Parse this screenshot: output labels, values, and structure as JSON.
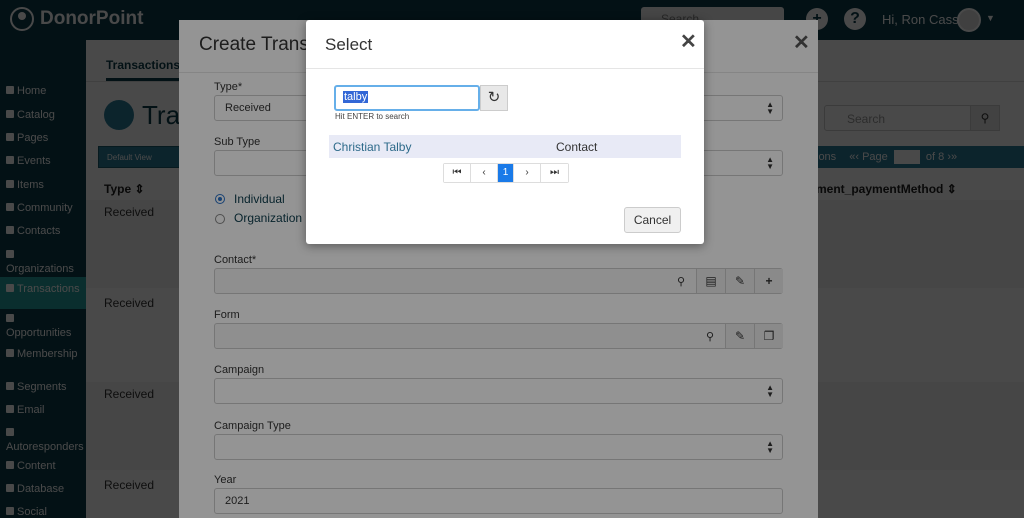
{
  "app": {
    "name": "DonorPoint",
    "search_placeholder": "Search",
    "greeting": "Hi, Ron Cass"
  },
  "sidebar": {
    "items": [
      {
        "label": "Home"
      },
      {
        "label": "Catalog"
      },
      {
        "label": "Pages"
      },
      {
        "label": "Events"
      },
      {
        "label": "Items"
      },
      {
        "label": "Community"
      },
      {
        "label": "Contacts"
      },
      {
        "label": "Organizations"
      },
      {
        "label": "Transactions"
      },
      {
        "label": "Opportunities"
      },
      {
        "label": "Membership"
      },
      {
        "label": "Segments"
      },
      {
        "label": "Email"
      },
      {
        "label": "Autoresponders"
      },
      {
        "label": "Content"
      },
      {
        "label": "Database"
      },
      {
        "label": "Social"
      }
    ],
    "active": "Transactions"
  },
  "page": {
    "tab": "Transactions",
    "title": "Tra",
    "search_placeholder": "Search",
    "view_select": "Default View",
    "pager_prefix": "ions",
    "pager_page_label": "Page",
    "pager_page_value": "1",
    "pager_of": "of 8",
    "columns": [
      "Type",
      "ment_paymentMethod"
    ],
    "rows": [
      "Received",
      "Received",
      "Received",
      "Received"
    ]
  },
  "create_modal": {
    "title": "Create Trans",
    "fields": {
      "type": {
        "label": "Type*",
        "value": "Received"
      },
      "sub_type": {
        "label": "Sub Type",
        "value": ""
      },
      "contact": {
        "label": "Contact*",
        "value": ""
      },
      "form": {
        "label": "Form",
        "value": ""
      },
      "campaign": {
        "label": "Campaign",
        "value": ""
      },
      "campaign_type": {
        "label": "Campaign Type",
        "value": ""
      },
      "year": {
        "label": "Year",
        "value": "2021"
      }
    },
    "radios": [
      {
        "label": "Individual",
        "checked": true
      },
      {
        "label": "Organization",
        "checked": false
      }
    ]
  },
  "select_dialog": {
    "title": "Select",
    "search_value": "talby",
    "hint": "Hit ENTER to search",
    "results": [
      {
        "name": "Christian Talby",
        "type": "Contact"
      }
    ],
    "pagination": {
      "current": "1"
    },
    "cancel_label": "Cancel"
  },
  "colors": {
    "topbar": "#0c3c4b",
    "active_nav": "#24a1a0",
    "primary": "#1a7ae8"
  }
}
